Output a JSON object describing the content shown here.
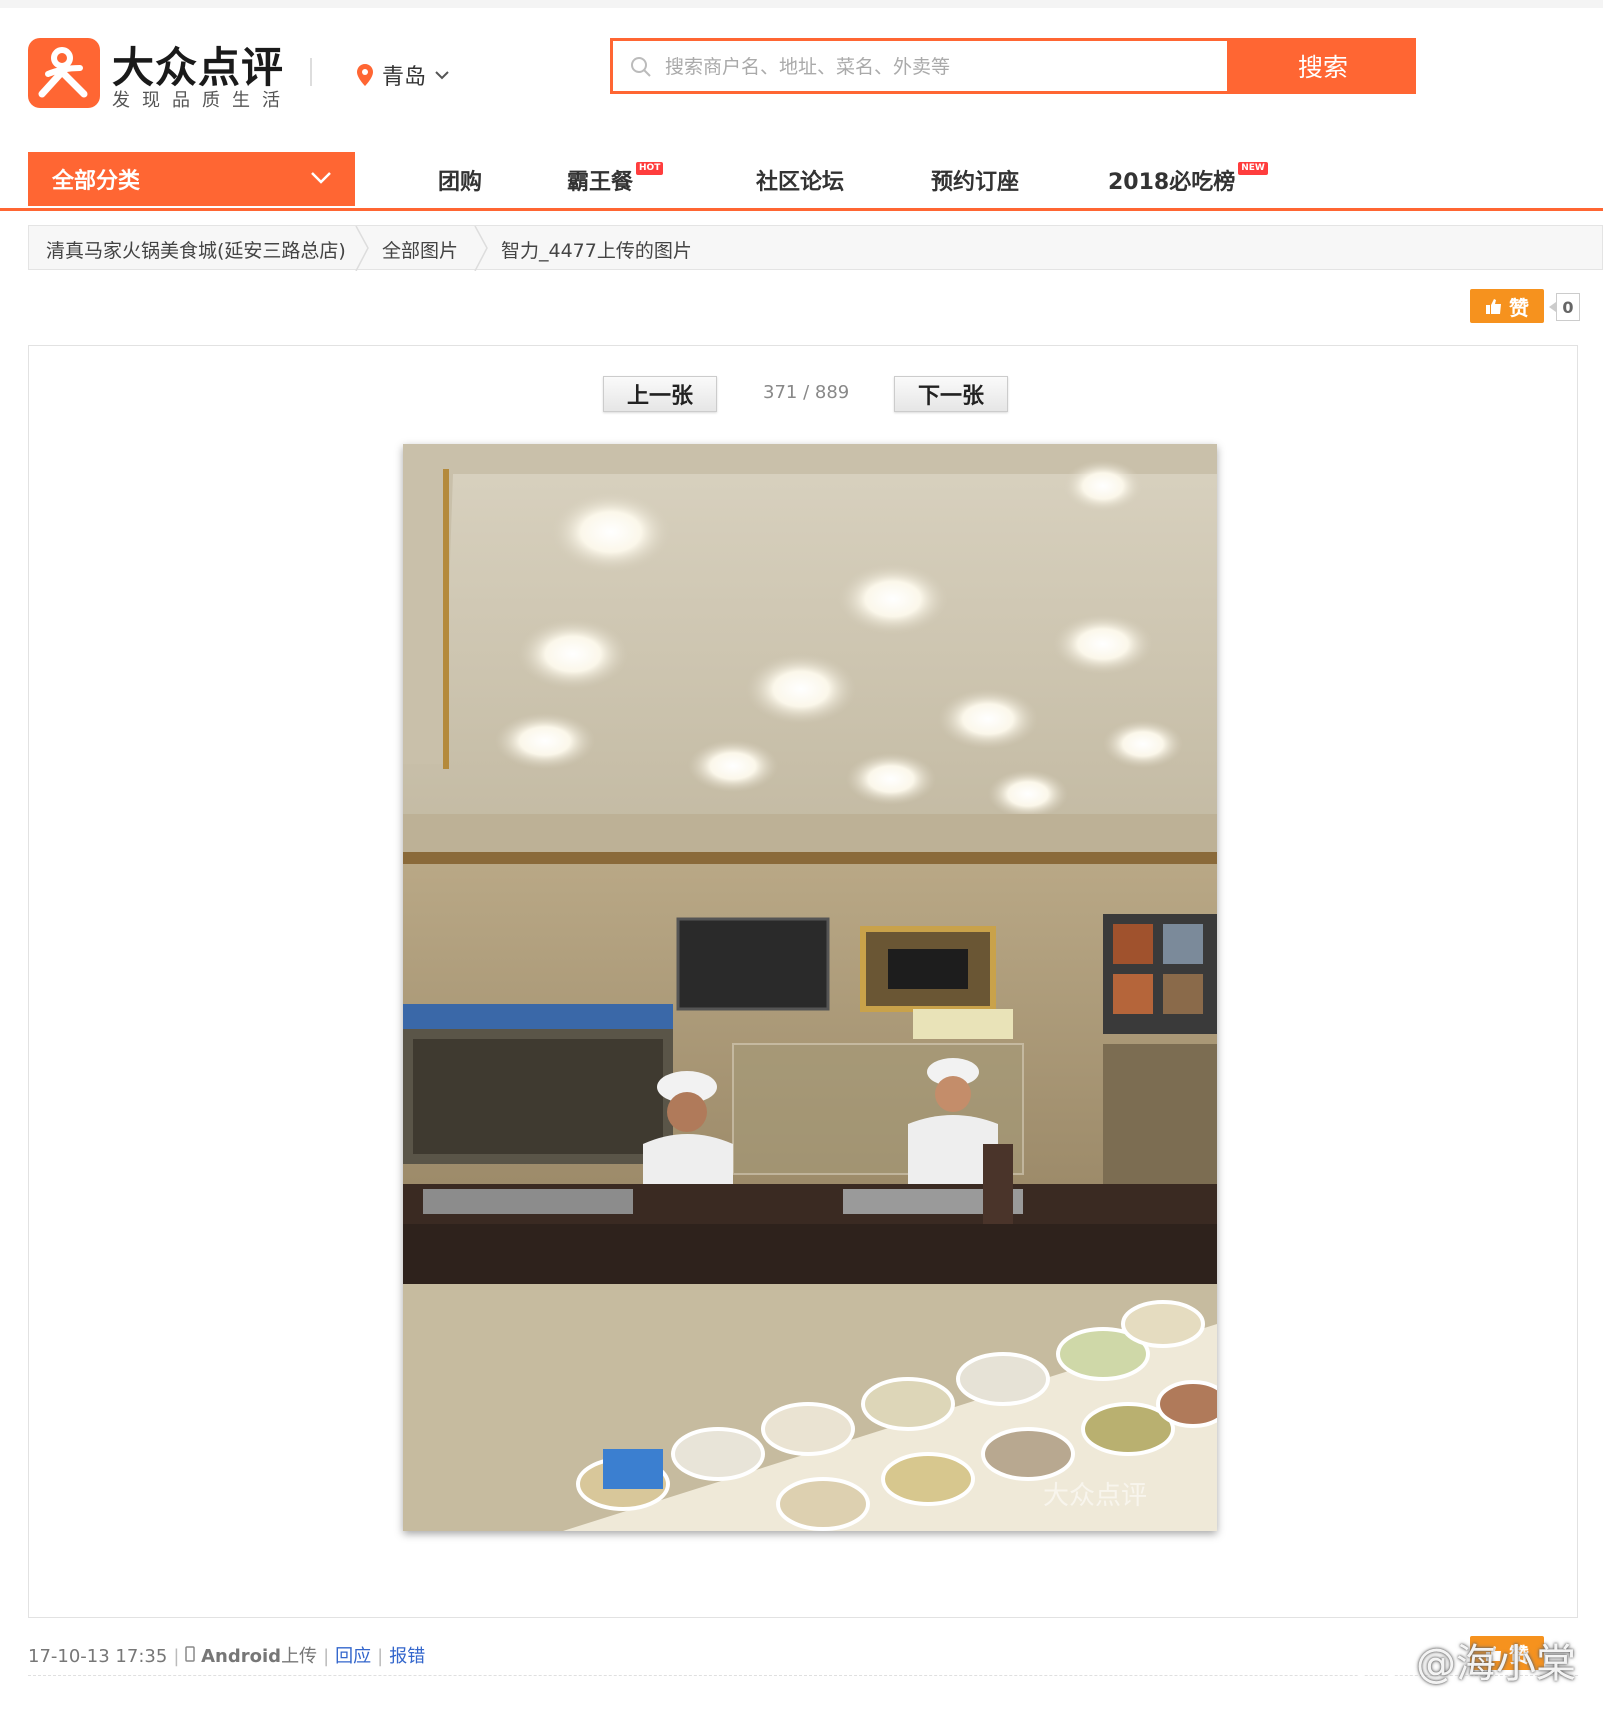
{
  "header": {
    "brand_name": "大众点评",
    "slogan": "发现品质生活",
    "city": "青岛",
    "search_placeholder": "搜索商户名、地址、菜名、外卖等",
    "search_button": "搜索"
  },
  "nav": {
    "all_categories": "全部分类",
    "items": [
      {
        "label": "团购",
        "badge": ""
      },
      {
        "label": "霸王餐",
        "badge": "HOT"
      },
      {
        "label": "社区论坛",
        "badge": ""
      },
      {
        "label": "预约订座",
        "badge": ""
      },
      {
        "label": "2018必吃榜",
        "badge": "NEW"
      }
    ]
  },
  "breadcrumb": [
    "清真马家火锅美食城(延安三路总店)",
    "全部图片",
    "智力_4477上传的图片"
  ],
  "like": {
    "label": "赞",
    "count": "0"
  },
  "pager": {
    "prev": "上一张",
    "next": "下一张",
    "counter": "371 / 889"
  },
  "photo": {
    "description_icon": "restaurant-photo",
    "overlay_text": "大众点评"
  },
  "meta": {
    "date": "17-10-13 17:35",
    "platform": "Android",
    "upload_suffix": "上传",
    "reply": "回应",
    "report": "报错"
  },
  "watermark": "@海小棠",
  "colors": {
    "accent": "#ff6633",
    "like": "#f6921e",
    "link": "#3366cc"
  }
}
